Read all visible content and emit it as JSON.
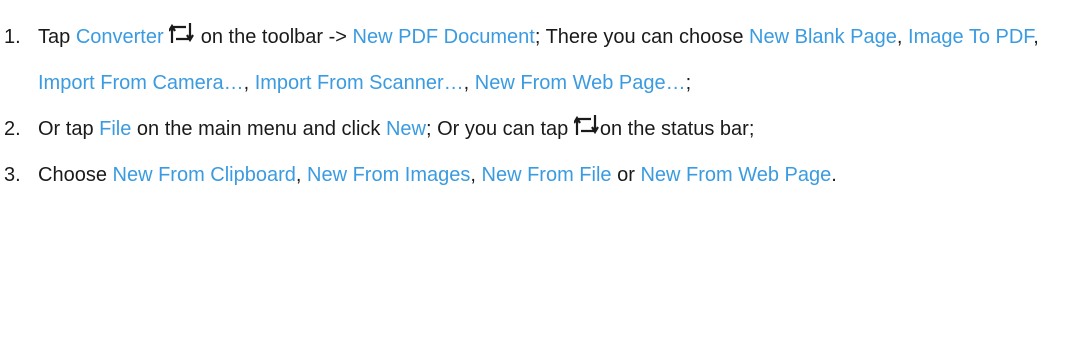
{
  "step1": {
    "num": "1.",
    "t1": "Tap ",
    "converter": "Converter",
    "t2": " on the toolbar -> ",
    "new_pdf_document": "New PDF Document",
    "t3": "; There you can choose ",
    "new_blank_page": "New Blank Page",
    "t4": ", ",
    "image_to_pdf": "Image To PDF",
    "t5": ", ",
    "import_from_camera": "Import From Camera…",
    "t6": ", ",
    "import_from_scanner": "Import From Scanner…",
    "t7": ", ",
    "new_from_web_page": "New From Web Page…",
    "t8": ";"
  },
  "step2": {
    "num": "2.",
    "t1": "Or tap ",
    "file": "File",
    "t2": " on the main menu and click ",
    "new": "New",
    "t3": "; Or you can tap ",
    "t4": "on the status bar;"
  },
  "step3": {
    "num": "3.",
    "t1": "Choose ",
    "new_from_clipboard": "New From Clipboard",
    "t2": ", ",
    "new_from_images": "New From Images",
    "t3": ", ",
    "new_from_file": "New From File",
    "t4": " or ",
    "new_from_web_page": "New From Web Page",
    "t5": "."
  },
  "icons": {
    "converter_icon": "converter-icon",
    "status_bar_icon": "new-document-icon"
  },
  "colors": {
    "link": "#3a9be0",
    "text": "#1a1a1a",
    "icon": "#1a1a1a"
  }
}
